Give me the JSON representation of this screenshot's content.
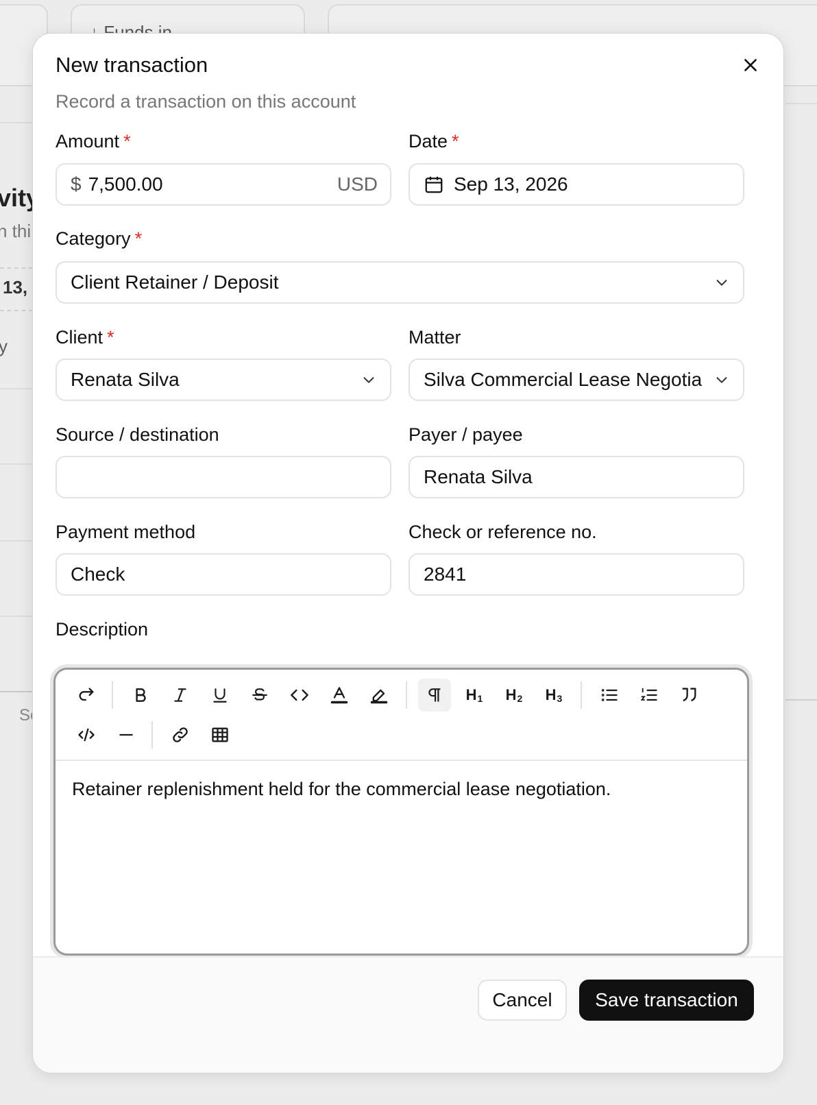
{
  "background": {
    "card_label": "↓ Funds in",
    "partial_title": "vity",
    "partial_subtitle": "n thi",
    "partial_date": "13,",
    "partial_row": "y",
    "partial_footer": "Se"
  },
  "modal": {
    "title": "New transaction",
    "subtitle": "Record a transaction on this account"
  },
  "fields": {
    "amount": {
      "label": "Amount",
      "required": "*",
      "prefix": "$",
      "value": "7,500.00",
      "currency": "USD"
    },
    "date": {
      "label": "Date",
      "required": "*",
      "value": "Sep 13, 2026"
    },
    "category": {
      "label": "Category",
      "required": "*",
      "value": "Client Retainer / Deposit"
    },
    "client": {
      "label": "Client",
      "required": "*",
      "value": "Renata Silva"
    },
    "matter": {
      "label": "Matter",
      "value": "Silva Commercial Lease Negotiat"
    },
    "source": {
      "label": "Source / destination",
      "value": ""
    },
    "payer": {
      "label": "Payer / payee",
      "value": "Renata Silva"
    },
    "payment_method": {
      "label": "Payment method",
      "value": "Check"
    },
    "reference": {
      "label": "Check or reference no.",
      "value": "2841"
    },
    "description": {
      "label": "Description",
      "value": "Retainer replenishment held for the commercial lease negotiation."
    }
  },
  "toolbar": {
    "h1": "H",
    "h1_sub": "1",
    "h2": "H",
    "h2_sub": "2",
    "h3": "H",
    "h3_sub": "3"
  },
  "actions": {
    "cancel": "Cancel",
    "save": "Save transaction"
  },
  "colors": {
    "accent": "#111111",
    "required": "#d92d20"
  }
}
